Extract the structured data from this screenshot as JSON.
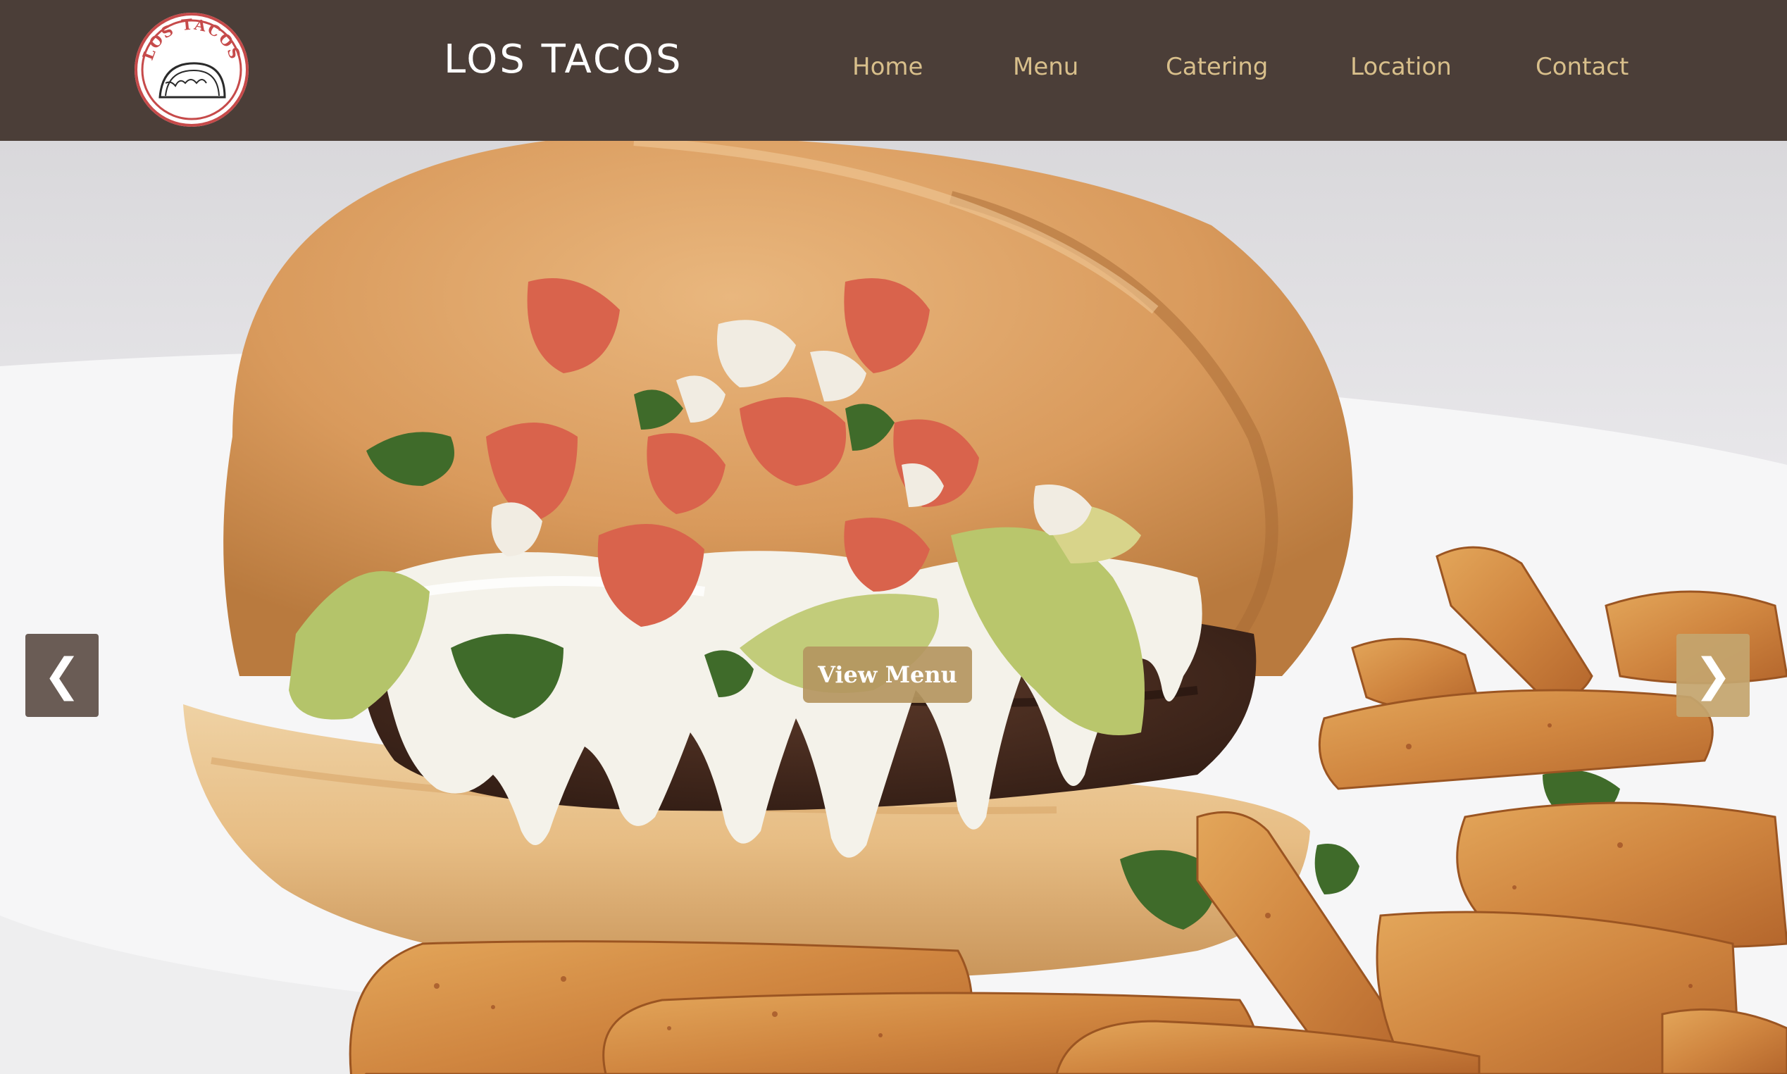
{
  "header": {
    "logo_text": "LOS TACOS",
    "brand": "LOS TACOS"
  },
  "nav": {
    "items": [
      {
        "label": "Home"
      },
      {
        "label": "Menu"
      },
      {
        "label": "Catering"
      },
      {
        "label": "Location"
      },
      {
        "label": "Contact"
      }
    ]
  },
  "hero": {
    "cta_label": "View Menu",
    "prev_symbol": "❮",
    "next_symbol": "❯"
  },
  "colors": {
    "header_bg": "#4b3e38",
    "nav_text": "#d8bf8b",
    "cta_bg": "#b4965f",
    "logo_accent": "#c64a4a"
  }
}
